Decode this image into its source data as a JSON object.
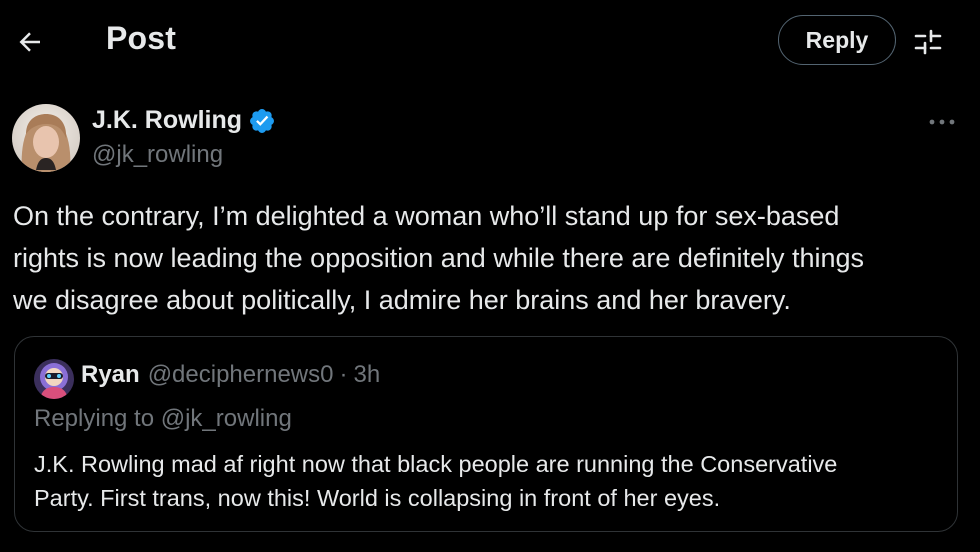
{
  "header": {
    "title": "Post",
    "reply_label": "Reply"
  },
  "author": {
    "name": "J.K. Rowling",
    "handle": "@jk_rowling",
    "verified": true
  },
  "post": {
    "text": "On the contrary, I’m delighted a woman who’ll stand up for sex-based\nrights is now leading the opposition and while there are definitely things\nwe disagree about politically, I admire her brains and her bravery."
  },
  "quoted_post": {
    "name": "Ryan",
    "handle": "@deciphernews0",
    "separator": "·",
    "time": "3h",
    "replying_to": "Replying to @jk_rowling",
    "text": "J.K. Rowling mad af right now that black people are running the Conservative\nParty. First trans, now this! World is collapsing in front of her eyes."
  },
  "icons": {
    "back": "arrow-left-icon",
    "settings": "sliders-icon",
    "more": "more-horizontal-icon",
    "verified": "verified-badge-icon"
  },
  "colors": {
    "background": "#000000",
    "text_primary": "#e7e9ea",
    "text_secondary": "#71767b",
    "border": "#2f3336",
    "verified_blue": "#1d9bf0"
  }
}
